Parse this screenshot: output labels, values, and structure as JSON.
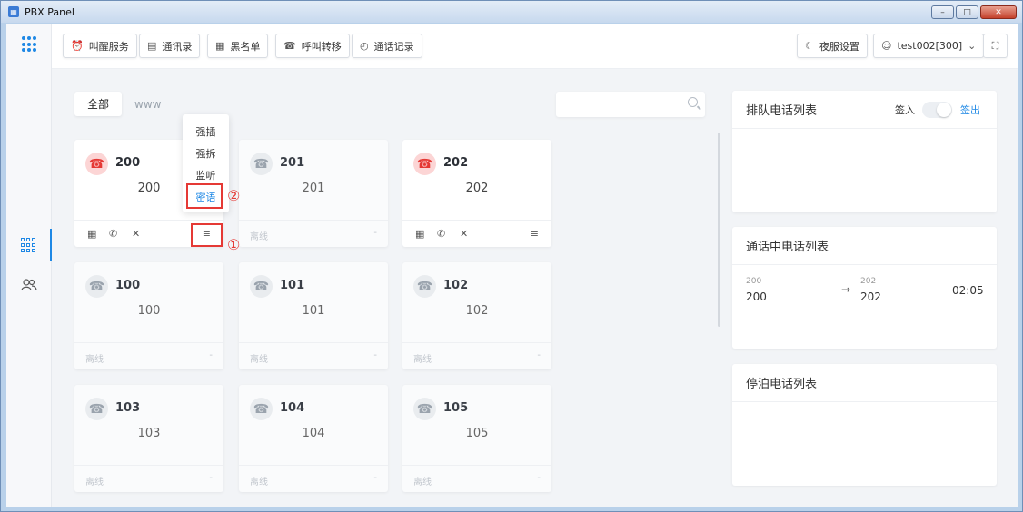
{
  "window": {
    "title": "PBX Panel",
    "min": "–",
    "max": "□",
    "close": "✕"
  },
  "toolbar": [
    {
      "icon": "⏰",
      "label": "叫醒服务"
    },
    {
      "icon": "▤",
      "label": "通讯录"
    },
    {
      "icon": "▦",
      "label": "黑名单"
    },
    {
      "icon": "☎",
      "label": "呼叫转移"
    },
    {
      "icon": "◴",
      "label": "通话记录"
    }
  ],
  "night_mode": {
    "icon": "☾",
    "label": "夜服设置"
  },
  "user": {
    "icon": "☺",
    "label": "test002[300]",
    "caret": "⌄"
  },
  "fullscreen": {
    "icon": "⛶"
  },
  "tabs": [
    {
      "label": "全部"
    },
    {
      "label": "www"
    }
  ],
  "search": {
    "placeholder": ""
  },
  "extensions": [
    {
      "title": "200",
      "name": "200",
      "state": "active",
      "status": "",
      "dash": ""
    },
    {
      "title": "201",
      "name": "201",
      "state": "offline",
      "status": "离线",
      "dash": "-"
    },
    {
      "title": "202",
      "name": "202",
      "state": "active",
      "status": "",
      "dash": ""
    },
    {
      "title": "100",
      "name": "100",
      "state": "offline",
      "status": "离线",
      "dash": "-"
    },
    {
      "title": "101",
      "name": "101",
      "state": "offline",
      "status": "离线",
      "dash": "-"
    },
    {
      "title": "102",
      "name": "102",
      "state": "offline",
      "status": "离线",
      "dash": "-"
    },
    {
      "title": "103",
      "name": "103",
      "state": "offline",
      "status": "离线",
      "dash": "-"
    },
    {
      "title": "104",
      "name": "104",
      "state": "offline",
      "status": "离线",
      "dash": "-"
    },
    {
      "title": "105",
      "name": "105",
      "state": "offline",
      "status": "离线",
      "dash": "-"
    }
  ],
  "card_icons": {
    "phone": "☎",
    "dialpad": "▦",
    "call": "✆",
    "hangup": "✕",
    "menu": "≡"
  },
  "dropdown": [
    "强插",
    "强拆",
    "监听",
    "密语"
  ],
  "markers": {
    "one": "①",
    "two": "②"
  },
  "panels": {
    "queue": {
      "title": "排队电话列表",
      "sign_in": "签入",
      "sign_out": "签出"
    },
    "in_call": {
      "title": "通话中电话列表"
    },
    "parked": {
      "title": "停泊电话列表"
    }
  },
  "call": {
    "from_small": "200",
    "from": "200",
    "arrow": "→",
    "to_small": "202",
    "to": "202",
    "duration": "02:05"
  },
  "colors": {
    "accent": "#1e88e5",
    "active_phone": "#e53935",
    "highlight": "#e53935"
  }
}
